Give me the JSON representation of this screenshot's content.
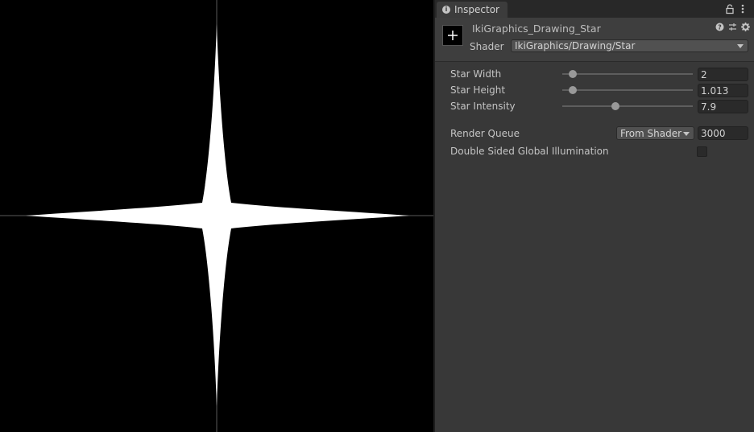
{
  "inspector": {
    "tab_label": "Inspector",
    "material_name": "IkiGraphics_Drawing_Star",
    "shader_label": "Shader",
    "shader_value": "IkiGraphics/Drawing/Star"
  },
  "properties": {
    "star_width": {
      "label": "Star Width",
      "value": "2",
      "slider_fraction": 0.08
    },
    "star_height": {
      "label": "Star Height",
      "value": "1.013",
      "slider_fraction": 0.08
    },
    "star_intensity": {
      "label": "Star Intensity",
      "value": "7.9",
      "slider_fraction": 0.41
    }
  },
  "render_queue": {
    "label": "Render Queue",
    "mode": "From Shader",
    "value": "3000"
  },
  "double_sided_gi": {
    "label": "Double Sided Global Illumination",
    "checked": false
  },
  "colors": {
    "scene_background": "#000000",
    "star": "#ffffff",
    "guide_lines": "#5a5a5a",
    "panel": "#383838"
  }
}
